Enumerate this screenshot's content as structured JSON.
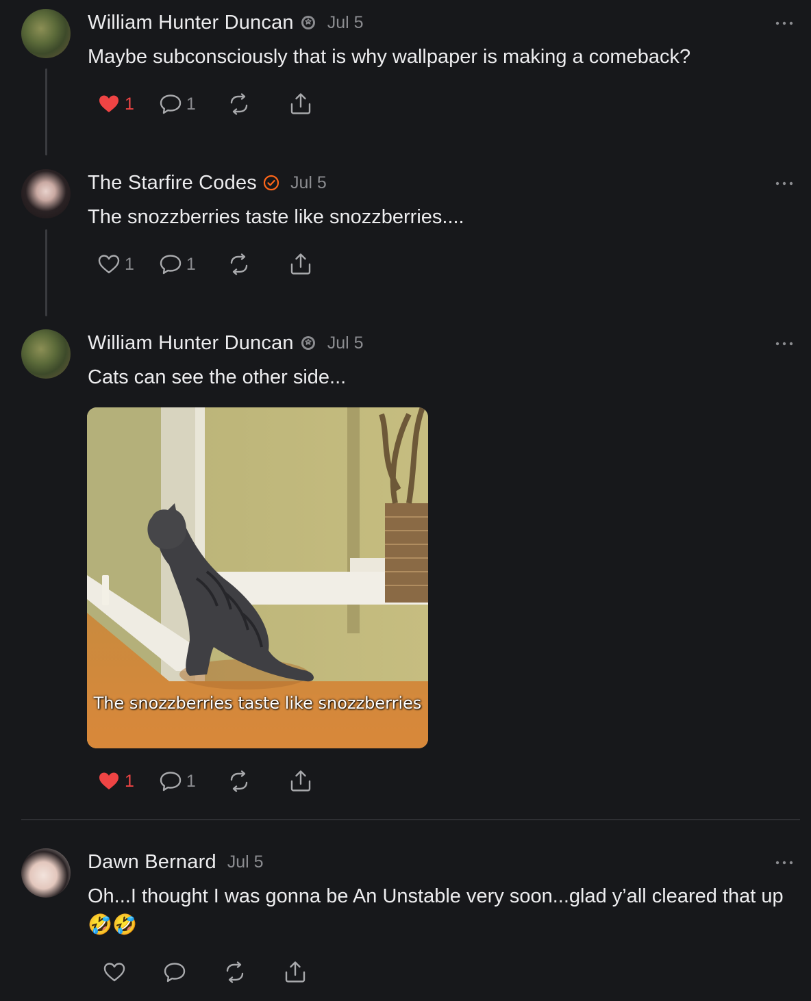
{
  "posts": [
    {
      "author": "William Hunter Duncan",
      "date": "Jul 5",
      "text": "Maybe subconsciously that is why wallpaper is making a comeback?",
      "likes": "1",
      "liked": true,
      "comments": "1"
    },
    {
      "author": "The Starfire Codes",
      "date": "Jul 5",
      "text": "The snozzberries taste like snozzberries....",
      "likes": "1",
      "liked": false,
      "comments": "1"
    },
    {
      "author": "William Hunter Duncan",
      "date": "Jul 5",
      "text": "Cats can see the other side...",
      "image_caption": "The snozzberries taste like snozzberries",
      "likes": "1",
      "liked": true,
      "comments": "1"
    },
    {
      "author": "Dawn Bernard",
      "date": "Jul 5",
      "text": "Oh...I thought I was gonna be An Unstable very soon...glad y’all cleared that up 🤣🤣"
    }
  ],
  "icons": {
    "like": "heart-icon",
    "comment": "comment-bubble-icon",
    "restack": "restack-icon",
    "share": "share-icon",
    "more": "more-options-icon",
    "badge_gear": "gear-badge-icon",
    "badge_check": "verified-check-icon"
  },
  "colors": {
    "background": "#17181b",
    "liked": "#ef4444",
    "accent_check": "#ff6719",
    "muted": "#8b8c90"
  }
}
